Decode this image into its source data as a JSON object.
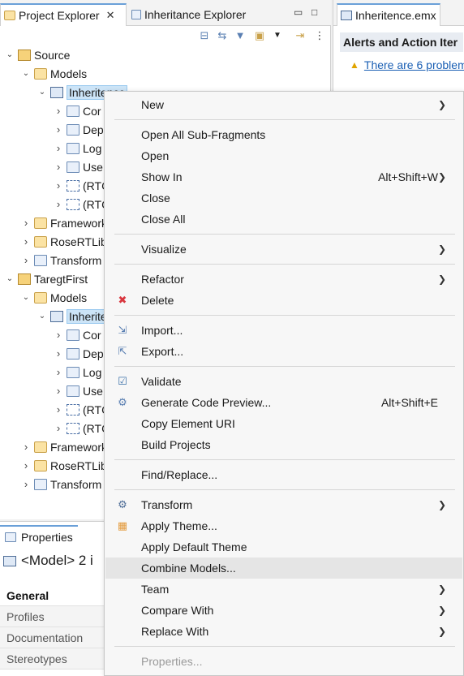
{
  "explorer": {
    "tabs": [
      {
        "label": "Project Explorer",
        "active": true,
        "closable": true,
        "icon": "project-explorer-icon"
      },
      {
        "label": "Inheritance Explorer",
        "active": false,
        "closable": false,
        "icon": "inheritance-explorer-icon"
      }
    ],
    "toolbar_icons": [
      "collapse-all-icon",
      "link-editor-icon",
      "filter-icon",
      "new-folder-icon",
      "view-menu-icon",
      "sync-icon",
      "more-icon"
    ],
    "tree": [
      {
        "label": "Source",
        "level": 0,
        "expanded": true,
        "icon": "project-icon"
      },
      {
        "label": "Models",
        "level": 1,
        "expanded": true,
        "icon": "models-icon"
      },
      {
        "label": "Inheritence",
        "level": 2,
        "expanded": true,
        "icon": "model-icon",
        "selected": true
      },
      {
        "label": "Cor",
        "level": 3,
        "expanded": false,
        "icon": "package-icon"
      },
      {
        "label": "Dep",
        "level": 3,
        "expanded": false,
        "icon": "package-icon"
      },
      {
        "label": "Log",
        "level": 3,
        "expanded": false,
        "icon": "package-icon"
      },
      {
        "label": "Use",
        "level": 3,
        "expanded": false,
        "icon": "package-icon"
      },
      {
        "label": "(RTC",
        "level": 3,
        "expanded": false,
        "icon": "rtc-icon"
      },
      {
        "label": "(RTC",
        "level": 3,
        "expanded": false,
        "icon": "rtc-icon"
      },
      {
        "label": "Framework",
        "level": 1,
        "expanded": false,
        "icon": "folder-icon"
      },
      {
        "label": "RoseRTLib",
        "level": 1,
        "expanded": false,
        "icon": "folder-icon"
      },
      {
        "label": "Transform",
        "level": 1,
        "expanded": false,
        "icon": "transform-icon"
      },
      {
        "label": "TaregtFirst",
        "level": 0,
        "expanded": true,
        "icon": "project-icon"
      },
      {
        "label": "Models",
        "level": 1,
        "expanded": true,
        "icon": "models-icon"
      },
      {
        "label": "Inherite",
        "level": 2,
        "expanded": true,
        "icon": "model-icon",
        "selected": true
      },
      {
        "label": "Cor",
        "level": 3,
        "expanded": false,
        "icon": "package-icon"
      },
      {
        "label": "Dep",
        "level": 3,
        "expanded": false,
        "icon": "package-icon"
      },
      {
        "label": "Log",
        "level": 3,
        "expanded": false,
        "icon": "package-icon"
      },
      {
        "label": "Use",
        "level": 3,
        "expanded": false,
        "icon": "package-icon"
      },
      {
        "label": "(RTC",
        "level": 3,
        "expanded": false,
        "icon": "rtc-icon"
      },
      {
        "label": "(RTC",
        "level": 3,
        "expanded": false,
        "icon": "rtc-icon"
      },
      {
        "label": "Framework",
        "level": 1,
        "expanded": false,
        "icon": "folder-icon"
      },
      {
        "label": "RoseRTLib",
        "level": 1,
        "expanded": false,
        "icon": "folder-icon"
      },
      {
        "label": "Transform",
        "level": 1,
        "expanded": false,
        "icon": "transform-icon"
      }
    ]
  },
  "editor": {
    "tab_label": "Inheritence.emx",
    "alerts_title": "Alerts and Action Iter",
    "alert_link": "There are 6 problem"
  },
  "properties": {
    "tab_label": "Properties",
    "title": "<Model> 2 i",
    "tabs": [
      {
        "label": "General",
        "active": true
      },
      {
        "label": "Profiles",
        "active": false
      },
      {
        "label": "Documentation",
        "active": false
      },
      {
        "label": "Stereotypes",
        "active": false
      }
    ]
  },
  "context_menu": {
    "items": [
      {
        "type": "item",
        "label": "New",
        "submenu": true
      },
      {
        "type": "sep"
      },
      {
        "type": "item",
        "label": "Open All Sub-Fragments"
      },
      {
        "type": "item",
        "label": "Open"
      },
      {
        "type": "item",
        "label": "Show In",
        "shortcut": "Alt+Shift+W",
        "submenu": true
      },
      {
        "type": "item",
        "label": "Close"
      },
      {
        "type": "item",
        "label": "Close All"
      },
      {
        "type": "sep"
      },
      {
        "type": "item",
        "label": "Visualize",
        "submenu": true
      },
      {
        "type": "sep"
      },
      {
        "type": "item",
        "label": "Refactor",
        "submenu": true
      },
      {
        "type": "item",
        "label": "Delete",
        "icon": "delete-icon"
      },
      {
        "type": "sep"
      },
      {
        "type": "item",
        "label": "Import...",
        "icon": "import-icon"
      },
      {
        "type": "item",
        "label": "Export...",
        "icon": "export-icon"
      },
      {
        "type": "sep"
      },
      {
        "type": "item",
        "label": "Validate",
        "icon": "validate-icon"
      },
      {
        "type": "item",
        "label": "Generate Code Preview...",
        "shortcut": "Alt+Shift+E",
        "icon": "code-preview-icon"
      },
      {
        "type": "item",
        "label": "Copy Element URI"
      },
      {
        "type": "item",
        "label": "Build Projects"
      },
      {
        "type": "sep"
      },
      {
        "type": "item",
        "label": "Find/Replace..."
      },
      {
        "type": "sep"
      },
      {
        "type": "item",
        "label": "Transform",
        "submenu": true,
        "icon": "transform-icon"
      },
      {
        "type": "item",
        "label": "Apply Theme...",
        "icon": "theme-icon"
      },
      {
        "type": "item",
        "label": "Apply Default Theme"
      },
      {
        "type": "item",
        "label": "Combine Models...",
        "hover": true
      },
      {
        "type": "item",
        "label": "Team",
        "submenu": true
      },
      {
        "type": "item",
        "label": "Compare With",
        "submenu": true
      },
      {
        "type": "item",
        "label": "Replace With",
        "submenu": true
      },
      {
        "type": "sep"
      },
      {
        "type": "item",
        "label": "Properties...",
        "disabled": true
      }
    ]
  },
  "colors": {
    "selection": "#cce4f7",
    "link": "#1a5fb4",
    "delete": "#d9363e",
    "warning": "#e0a400"
  }
}
